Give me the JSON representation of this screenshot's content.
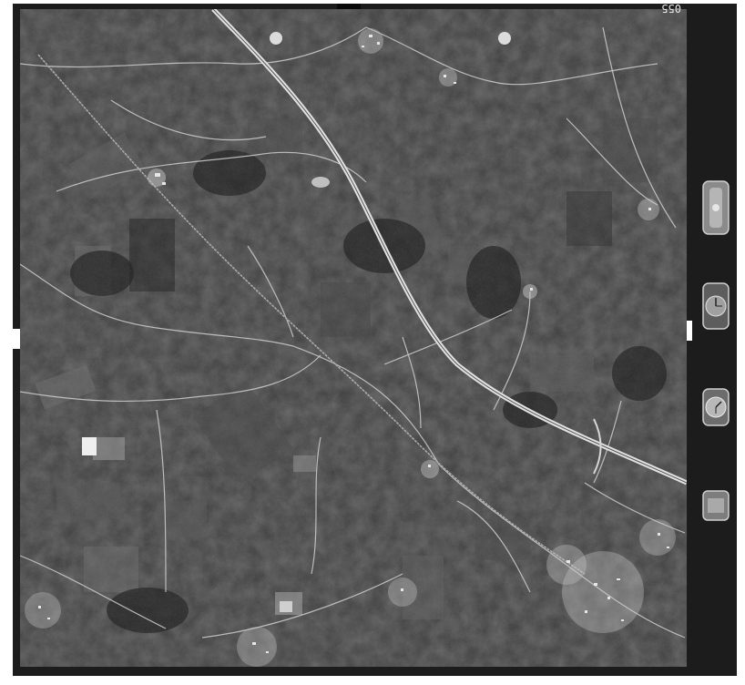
{
  "frame_number": "055",
  "colors": {
    "film_border": "#1c1c1c",
    "page_background": "#ffffff",
    "highway": "#d8d8d8",
    "roads": "#cfcfcf",
    "settlements": "#bdbdbd"
  },
  "instruments": [
    {
      "name": "level-bubble-icon"
    },
    {
      "name": "altimeter-dial-icon"
    },
    {
      "name": "clock-dial-icon"
    },
    {
      "name": "counter-window-icon"
    }
  ]
}
